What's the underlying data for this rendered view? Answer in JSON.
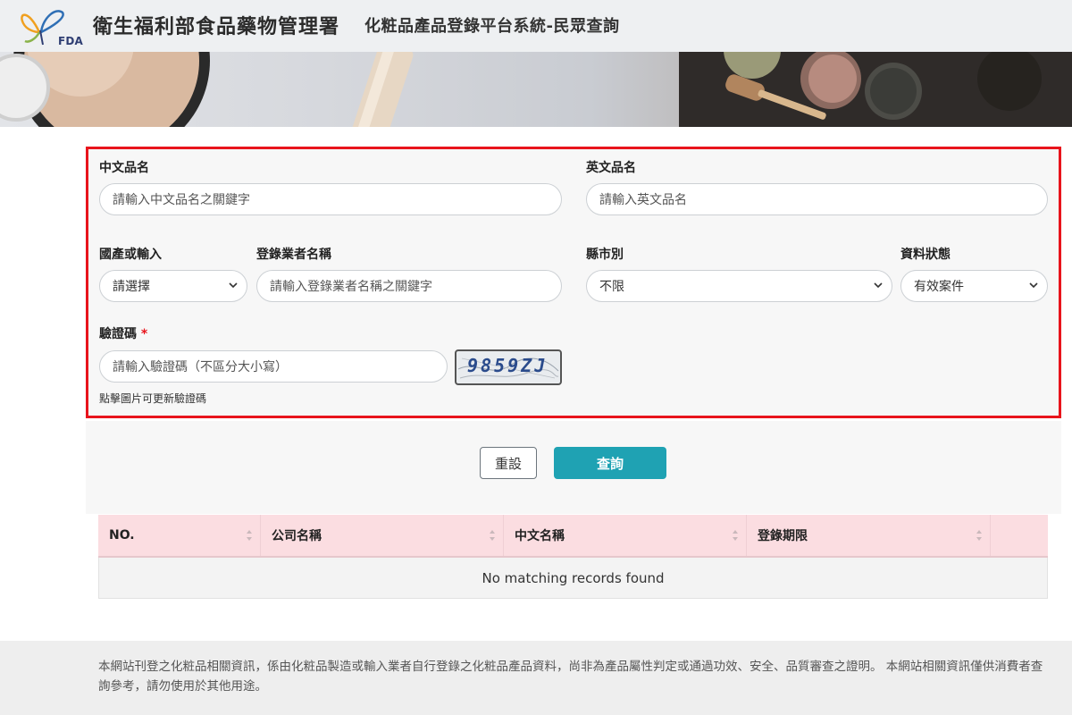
{
  "header": {
    "logo_text": "FDA",
    "agency_name": "衛生福利部食品藥物管理署",
    "system_title": "化粧品產品登錄平台系統-民眾查詢"
  },
  "form": {
    "chinese_name": {
      "label": "中文品名",
      "placeholder": "請輸入中文品名之關鍵字"
    },
    "english_name": {
      "label": "英文品名",
      "placeholder": "請輸入英文品名"
    },
    "origin": {
      "label": "國產或輸入",
      "value": "請選擇"
    },
    "company": {
      "label": "登錄業者名稱",
      "placeholder": "請輸入登錄業者名稱之關鍵字"
    },
    "city": {
      "label": "縣市別",
      "value": "不限"
    },
    "status": {
      "label": "資料狀態",
      "value": "有效案件"
    },
    "captcha": {
      "label": "驗證碼",
      "required_mark": "*",
      "placeholder": "請輸入驗證碼（不區分大小寫）",
      "code": "9859ZJ",
      "hint": "點擊圖片可更新驗證碼"
    }
  },
  "buttons": {
    "reset": "重設",
    "search": "查詢"
  },
  "table": {
    "columns": [
      "NO.",
      "公司名稱",
      "中文名稱",
      "登錄期限"
    ],
    "empty_message": "No matching records found"
  },
  "footer": {
    "disclaimer": "本網站刊登之化粧品相關資訊，係由化粧品製造或輸入業者自行登錄之化粧品產品資料，尚非為產品屬性判定或通過功效、安全、品質審查之證明。 本網站相關資訊僅供消費者查詢參考，請勿使用於其他用途。"
  },
  "colors": {
    "accent": "#1fa2b3",
    "highlight_border": "#e8141c",
    "table_header": "#fbdde1"
  }
}
